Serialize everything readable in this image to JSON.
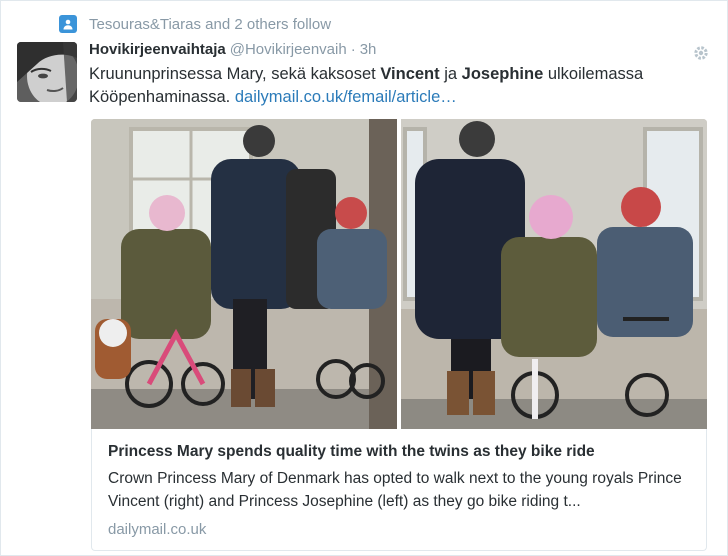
{
  "context": {
    "text": "Tesouras&Tiaras and 2 others follow",
    "icon": "person-icon"
  },
  "tweet": {
    "fullname": "Hovikirjeenvaihtaja",
    "screenname": "@Hovikirjeenvaih",
    "separator": "·",
    "time": "3h",
    "text_1": "Kruununprinsessa Mary, sekä kaksoset ",
    "text_vincent": "Vincent",
    "text_ja": " ja ",
    "text_josephine": "Josephine",
    "text_2": " ulkoilemassa Kööpenhaminassa. ",
    "link": "dailymail.co.uk/femail/article…"
  },
  "card": {
    "title": "Princess Mary spends quality time with the twins as they bike ride",
    "description": "Crown Princess Mary of Denmark has opted to walk next to the young royals Prince Vincent (right) and Princess Josephine (left) as they go bike riding t...",
    "domain": "dailymail.co.uk"
  },
  "colors": {
    "link": "#2b7bb9",
    "muted": "#8899a6",
    "accent": "#3b94d9"
  }
}
